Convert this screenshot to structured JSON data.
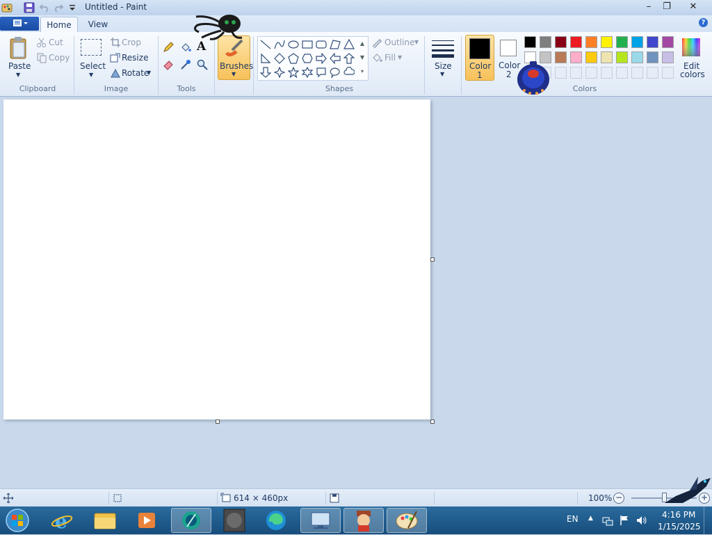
{
  "window": {
    "title": "Untitled - Paint"
  },
  "title_buttons": {
    "minimize": "–",
    "maximize": "❐",
    "close": "✕"
  },
  "tabs": {
    "home": "Home",
    "view": "View",
    "help": "?"
  },
  "clipboard": {
    "group": "Clipboard",
    "paste": "Paste",
    "cut": "Cut",
    "copy": "Copy"
  },
  "image": {
    "group": "Image",
    "select": "Select",
    "crop": "Crop",
    "resize": "Resize",
    "rotate": "Rotate"
  },
  "tools": {
    "group": "Tools",
    "text_icon": "A"
  },
  "brushes": {
    "label": "Brushes"
  },
  "shapes": {
    "group": "Shapes",
    "outline": "Outline",
    "fill": "Fill"
  },
  "size": {
    "label": "Size"
  },
  "colors": {
    "group": "Colors",
    "color1_label": "Color 1",
    "color1_line1": "Color",
    "color1_line2": "1",
    "color2_line1": "Color",
    "color2_line2": "2",
    "edit_line1": "Edit",
    "edit_line2": "colors",
    "color1": "#000000",
    "color2": "#ffffff",
    "palette_row1": [
      "#000000",
      "#7f7f7f",
      "#880015",
      "#ed1c24",
      "#ff7f27",
      "#fff200",
      "#22b14c",
      "#00a2e8",
      "#3f48cc",
      "#a349a4"
    ],
    "palette_row2": [
      "#ffffff",
      "#c3c3c3",
      "#b97a57",
      "#ffaec9",
      "#ffc90e",
      "#efe4b0",
      "#b5e61d",
      "#99d9ea",
      "#7092be",
      "#c8bfe7"
    ]
  },
  "status": {
    "dimensions": "614 × 460px",
    "zoom": "100%",
    "zoom_minus": "−",
    "zoom_plus": "+"
  },
  "taskbar": {
    "language": "EN",
    "time": "4:16 PM",
    "date": "1/15/2025"
  }
}
